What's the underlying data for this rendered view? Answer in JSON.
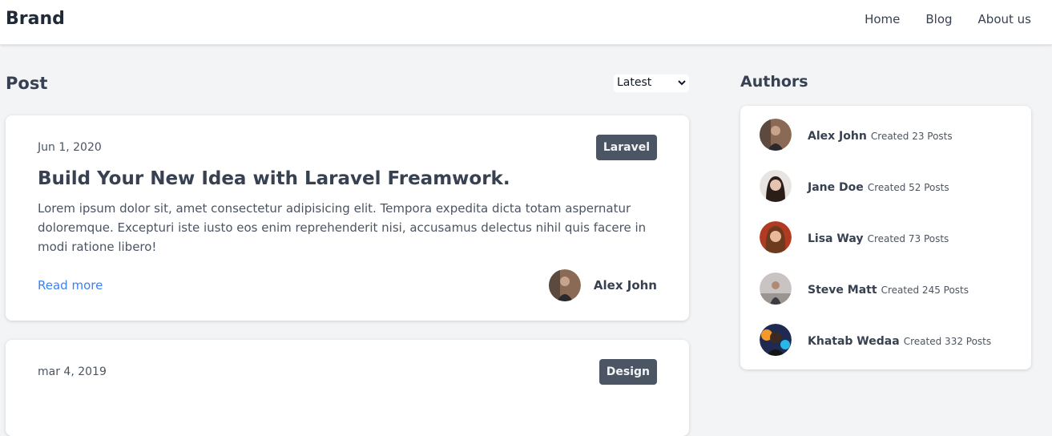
{
  "nav": {
    "brand": "Brand",
    "links": [
      "Home",
      "Blog",
      "About us"
    ]
  },
  "posts_section": {
    "heading": "Post",
    "sort": {
      "selected": "Latest"
    }
  },
  "posts": [
    {
      "date": "Jun 1, 2020",
      "tag": "Laravel",
      "title": "Build Your New Idea with Laravel Freamwork.",
      "excerpt": "Lorem ipsum dolor sit, amet consectetur adipisicing elit. Tempora expedita dicta totam aspernatur doloremque. Excepturi iste iusto eos enim reprehenderit nisi, accusamus delectus nihil quis facere in modi ratione libero!",
      "read_more": "Read more",
      "author": "Alex John"
    },
    {
      "date": "mar 4, 2019",
      "tag": "Design"
    }
  ],
  "authors_section": {
    "heading": "Authors",
    "authors": [
      {
        "name": "Alex John",
        "count": "Created 23 Posts"
      },
      {
        "name": "Jane Doe",
        "count": "Created 52 Posts"
      },
      {
        "name": "Lisa Way",
        "count": "Created 73 Posts"
      },
      {
        "name": "Steve Matt",
        "count": "Created 245 Posts"
      },
      {
        "name": "Khatab Wedaa",
        "count": "Created 332 Posts"
      }
    ]
  },
  "colors": {
    "background": "#f3f4f6",
    "link": "#3b82f6",
    "tag": "#4b5563"
  }
}
